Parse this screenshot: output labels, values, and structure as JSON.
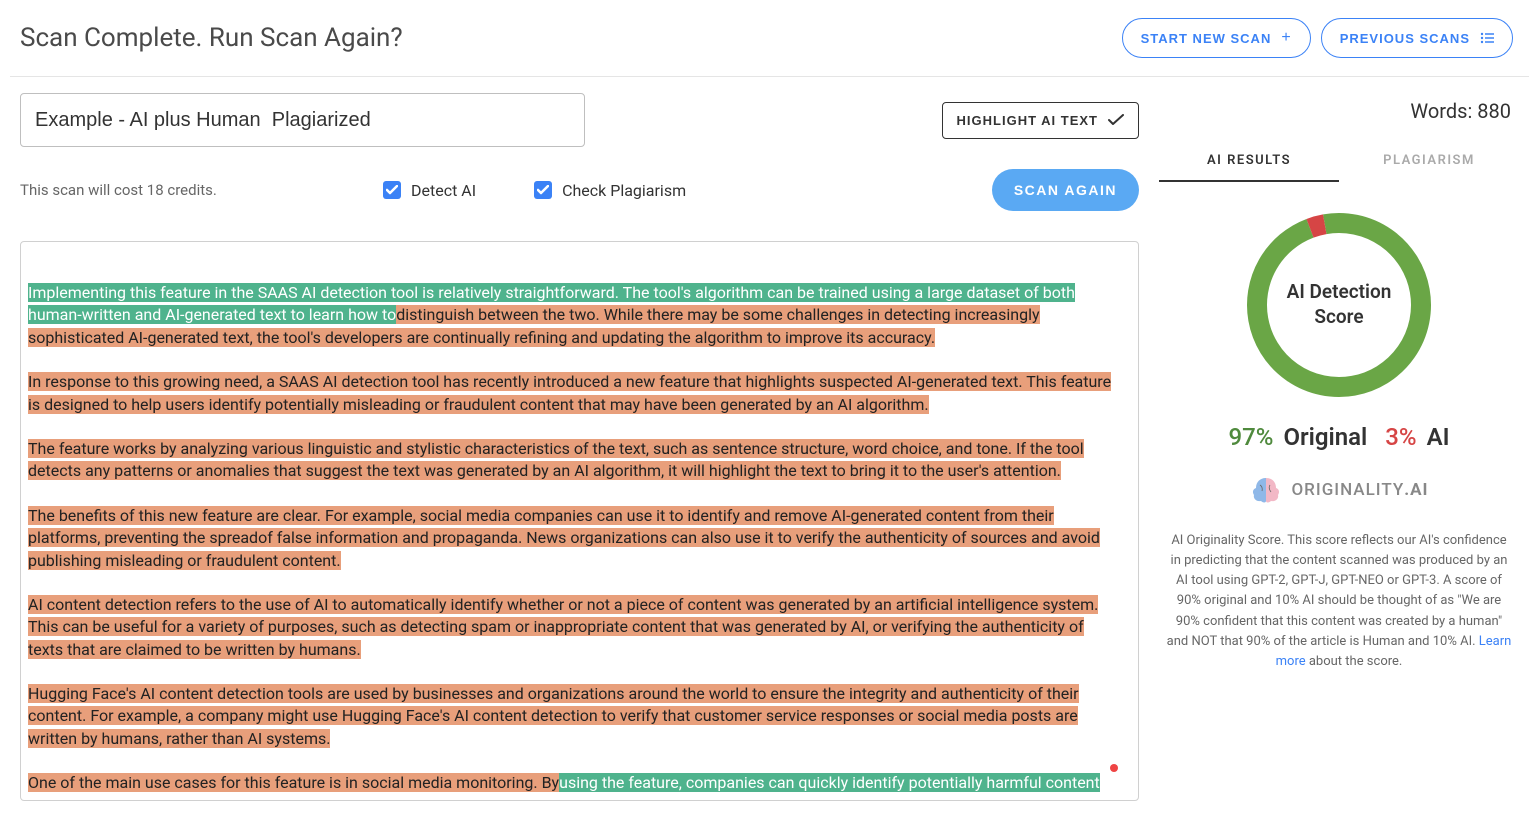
{
  "header": {
    "title": "Scan Complete. Run Scan Again?",
    "new_scan_label": "START NEW SCAN",
    "prev_scans_label": "PREVIOUS SCANS"
  },
  "scan": {
    "title_value": "Example - AI plus Human  Plagiarized",
    "highlight_btn": "HIGHLIGHT AI TEXT",
    "credit_text": "This scan will cost 18 credits.",
    "detect_ai_label": "Detect AI",
    "check_plag_label": "Check Plagiarism",
    "scan_again_label": "SCAN AGAIN"
  },
  "content": {
    "p1_green": "Implementing this feature in the SAAS AI detection tool is relatively straightforward. The tool's algorithm can be trained using a large dataset of both human-written and AI-generated text to learn how to",
    "p1_orange": "distinguish between the two. While there may be some challenges in detecting increasingly sophisticated AI-generated text, the tool's developers are continually refining and updating the algorithm to improve its accuracy.",
    "p2": "In response to this growing need, a SAAS AI detection tool has recently introduced a new feature that highlights suspected AI-generated text. This feature is designed to help users identify potentially misleading or fraudulent content that may have been generated by an AI algorithm.",
    "p3": "The feature works by analyzing various linguistic and stylistic characteristics of the text, such as sentence structure, word choice, and tone. If the tool detects any patterns or anomalies that suggest the text was generated by an AI algorithm, it will highlight the text to bring it to the user's attention.",
    "p4": "The benefits of this new feature are clear. For example, social media companies can use it to identify and remove AI-generated content from their platforms, preventing the spreadof false information and propaganda. News organizations can also use it to verify the authenticity of sources and avoid publishing misleading or fraudulent content.",
    "p5": "AI content detection refers to the use of AI to automatically identify whether or not a piece of content was generated by an artificial intelligence system. This can be useful for a variety of purposes, such as detecting spam or inappropriate content that was generated by AI, or verifying the authenticity of texts that are claimed to be written by humans.",
    "p6": "Hugging Face's AI content detection tools are used by businesses and organizations around the world to ensure the integrity and authenticity of their content. For example, a company might use Hugging Face's AI content detection to verify that customer service responses or social media posts are written by humans, rather than AI systems.",
    "p7_orange": "One of the main use cases for this feature is in social media monitoring. By",
    "p7_green": "using the feature, companies can quickly identify potentially harmful content"
  },
  "sidebar": {
    "word_count_label": "Words: 880",
    "tab_ai": "AI RESULTS",
    "tab_plag": "PLAGIARISM",
    "donut_label_line1": "AI Detection",
    "donut_label_line2": "Score",
    "original_pct": "97%",
    "original_label": "Original",
    "ai_pct": "3%",
    "ai_label": "AI",
    "brand_name_main": "ORIGINALITY",
    "brand_name_suffix": ".AI",
    "explain_main": "AI Originality Score. This score reflects our AI's confidence in predicting that the content scanned was produced by an AI tool using GPT-2, GPT-J, GPT-NEO or GPT-3. A score of 90% original and 10% AI should be thought of as \"We are 90% confident that this content was created by a human\" and NOT that 90% of the article is Human and 10% AI. ",
    "explain_link": "Learn more",
    "explain_suffix": " about the score."
  },
  "chart_data": {
    "type": "pie",
    "title": "AI Detection Score",
    "series": [
      {
        "name": "Original",
        "value": 97,
        "color": "#6aa646"
      },
      {
        "name": "AI",
        "value": 3,
        "color": "#d64545"
      }
    ]
  }
}
